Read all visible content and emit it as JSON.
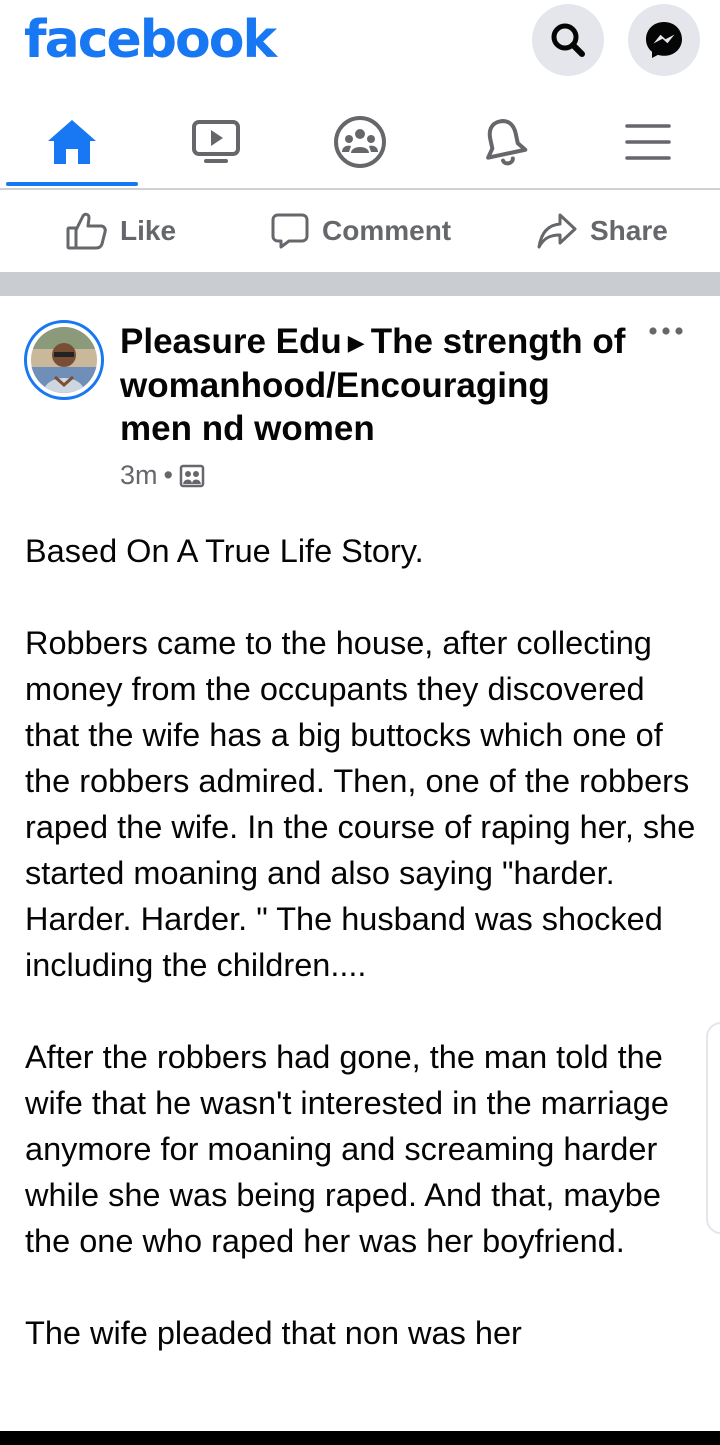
{
  "topbar": {
    "logo_text": "facebook",
    "search_icon": "search-icon",
    "messenger_icon": "messenger-icon"
  },
  "tabs": [
    {
      "name": "home",
      "icon": "home-icon",
      "active": true
    },
    {
      "name": "watch",
      "icon": "video-icon",
      "active": false
    },
    {
      "name": "groups",
      "icon": "groups-icon",
      "active": false
    },
    {
      "name": "notifications",
      "icon": "bell-icon",
      "active": false
    },
    {
      "name": "menu",
      "icon": "hamburger-icon",
      "active": false
    }
  ],
  "actions": {
    "like_label": "Like",
    "comment_label": "Comment",
    "share_label": "Share"
  },
  "post": {
    "author": "Pleasure Edu",
    "group": "The strength of womanhood/Encouraging men nd women",
    "time": "3m",
    "separator": "•",
    "paragraphs": [
      "Based On A True Life Story.",
      "Robbers came to the house, after collecting money from the occupants they discovered that the wife has a big buttocks which one of the robbers admired. Then, one of the robbers raped the wife. In the course of raping her, she started moaning and also saying \"harder. Harder. Harder. \" The husband was shocked including the children....",
      "After the robbers had gone, the man told the wife that he wasn't interested in the marriage anymore for moaning and screaming harder while she was being raped. And that, maybe the one who raped her was her boyfriend.",
      "The wife pleaded that non was her"
    ]
  },
  "colors": {
    "brand": "#1877f2",
    "icon_gray": "#65676b",
    "divider": "#c9ccd1"
  }
}
